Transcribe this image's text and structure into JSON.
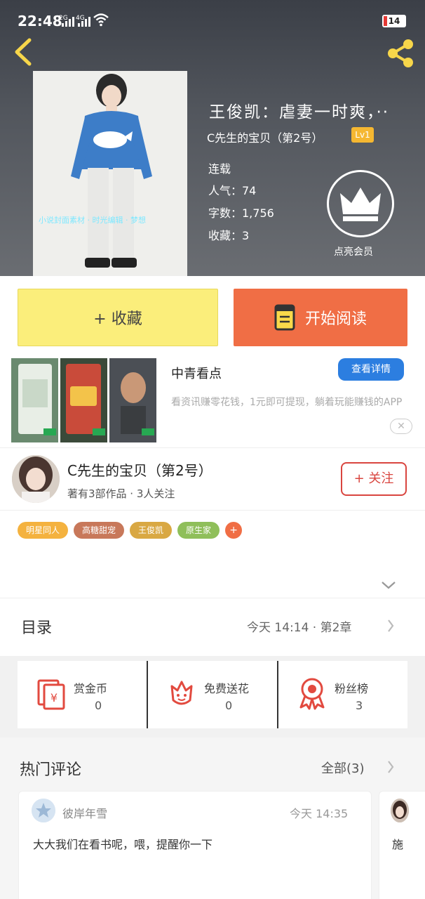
{
  "status_bar": {
    "time": "22:48",
    "network_1": "2G",
    "network_2": "4G",
    "battery": "14"
  },
  "book": {
    "title": "王俊凯：虐妻一时爽，··",
    "author_line": "C先生的宝贝（第2号）",
    "level_badge": "Lv1",
    "status": "连载",
    "popularity": "人气：74",
    "word_count": "字数：1,756",
    "favorites": "收藏：3",
    "cover_watermark": "小说封面素材 · 时光编辑 · 梦想"
  },
  "vip": {
    "label": "点亮会员"
  },
  "actions": {
    "collect_label": "+ 收藏",
    "read_label": "开始阅读",
    "read_icon": "book-icon"
  },
  "ad": {
    "name": "中青看点",
    "detail_button": "查看详情",
    "description": "看资讯赚零花钱，1元即可提现，躺着玩能赚钱的APP",
    "close": "✕"
  },
  "author": {
    "name": "C先生的宝贝（第2号）",
    "stats": "著有3部作品 · 3人关注",
    "follow_button": "+ 关注"
  },
  "tags": [
    {
      "label": "明星同人",
      "color": "#f4b23f"
    },
    {
      "label": "高糖甜宠",
      "color": "#c8785a"
    },
    {
      "label": "王俊凯",
      "color": "#d9a843"
    },
    {
      "label": "原生家",
      "color": "#8fbf5a"
    }
  ],
  "tag_add": "+",
  "toc": {
    "label": "目录",
    "latest": "今天 14:14 · 第2章"
  },
  "rewards": [
    {
      "label": "赏金币",
      "value": "0",
      "icon": "coin-envelope-icon"
    },
    {
      "label": "免费送花",
      "value": "0",
      "icon": "flower-icon"
    },
    {
      "label": "粉丝榜",
      "value": "3",
      "icon": "medal-icon"
    }
  ],
  "comments": {
    "title": "热门评论",
    "all_label": "全部(3)",
    "items": [
      {
        "user": "彼岸年雪",
        "time": "今天 14:35",
        "text": "大大我们在看书呢，喂，提醒你一下"
      },
      {
        "text": "施"
      }
    ]
  },
  "colors": {
    "collect": "#fbee7b",
    "read": "#f06e45",
    "follow": "#d9453f",
    "detail": "#2c7ee0",
    "reward_red": "#e24a3f"
  }
}
